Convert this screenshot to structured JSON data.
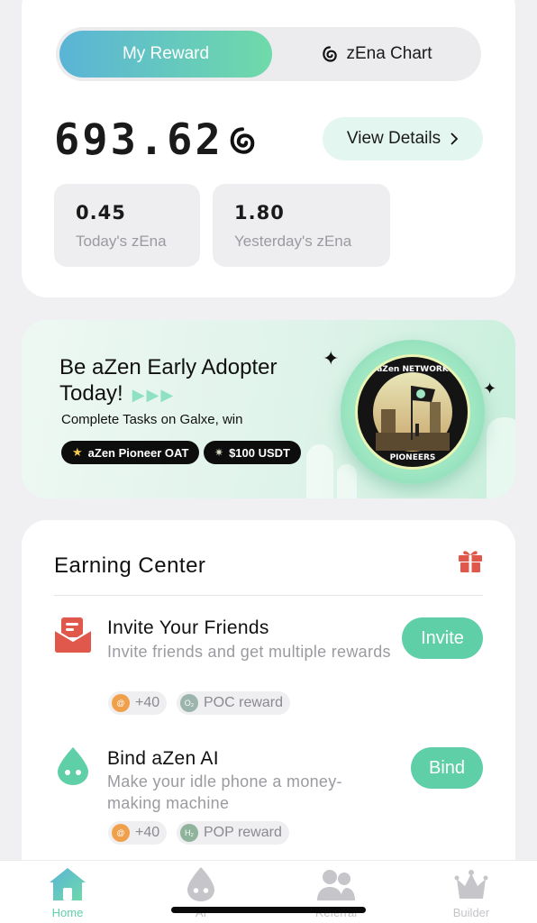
{
  "reward": {
    "tabs": {
      "active": "My Reward",
      "inactive": "zEna Chart"
    },
    "balance": "693.62",
    "view_details": "View Details",
    "stats": [
      {
        "value": "0.45",
        "label": "Today's zEna"
      },
      {
        "value": "1.80",
        "label": "Yesterday's zEna"
      }
    ]
  },
  "banner": {
    "title_line1": "Be aZen Early Adopter",
    "title_line2": "Today!",
    "arrows": "▶▶▶",
    "subtitle": "Complete Tasks on Galxe, win",
    "pill1": "aZen Pioneer OAT",
    "pill2": "$100 USDT",
    "badge_text_top": "aZen NETWORK",
    "badge_text_bottom": "PIONEERS"
  },
  "earning": {
    "title": "Earning Center",
    "tasks": [
      {
        "title": "Invite Your Friends",
        "desc": "Invite friends and get multiple rewards",
        "button": "Invite",
        "chip1": "+40",
        "chip2": "POC reward",
        "chip2_icon": "O₂"
      },
      {
        "title": "Bind aZen AI",
        "desc": "Make your idle phone a money-making machine",
        "button": "Bind",
        "chip1": "+40",
        "chip2": "POP reward",
        "chip2_icon": "H₂"
      }
    ]
  },
  "tabbar": {
    "items": [
      {
        "label": "Home",
        "icon": "home-icon"
      },
      {
        "label": "AI",
        "icon": "drop-face-icon"
      },
      {
        "label": "Referral",
        "icon": "people-icon"
      },
      {
        "label": "Builder",
        "icon": "crown-icon"
      }
    ]
  },
  "colors": {
    "accent": "#5fcfa8",
    "gradient_start": "#5ab4d6",
    "gradient_end": "#6fdaa9",
    "red": "#e0584c"
  }
}
